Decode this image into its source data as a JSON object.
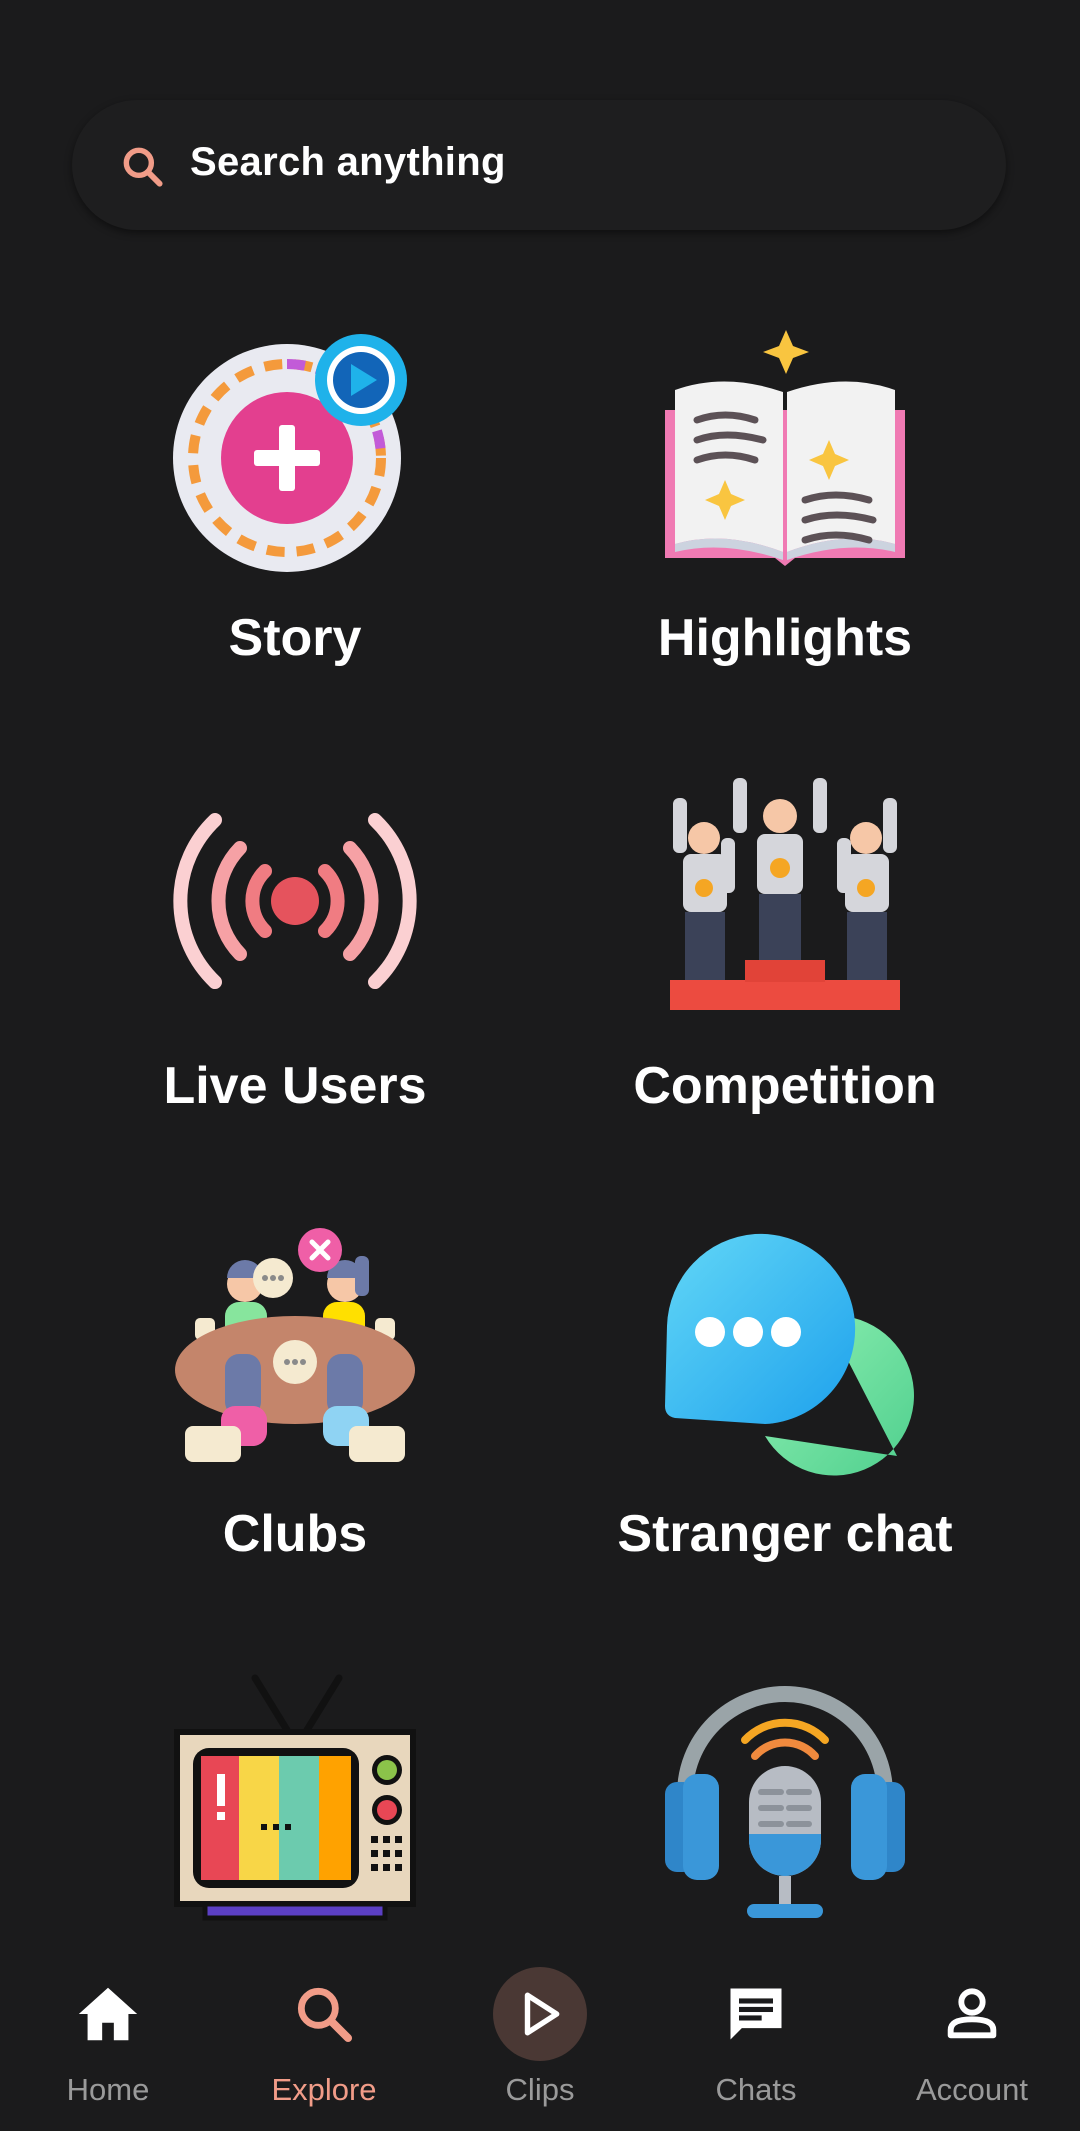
{
  "search": {
    "placeholder": "Search anything",
    "icon": "search-icon",
    "icon_color": "#f19c88"
  },
  "tiles": [
    {
      "label": "Story",
      "icon": "story-add-icon"
    },
    {
      "label": "Highlights",
      "icon": "open-book-icon"
    },
    {
      "label": "Live Users",
      "icon": "live-broadcast-icon"
    },
    {
      "label": "Competition",
      "icon": "podium-winners-icon"
    },
    {
      "label": "Clubs",
      "icon": "group-meeting-icon"
    },
    {
      "label": "Stranger chat",
      "icon": "chat-bubbles-icon"
    },
    {
      "label": "",
      "icon": "retro-tv-icon"
    },
    {
      "label": "",
      "icon": "podcast-microphone-icon"
    }
  ],
  "nav": {
    "active_color": "#f19c88",
    "items": [
      {
        "label": "Home",
        "icon": "home-icon"
      },
      {
        "label": "Explore",
        "icon": "search-icon",
        "active": true
      },
      {
        "label": "Clips",
        "icon": "play-icon"
      },
      {
        "label": "Chats",
        "icon": "chat-icon"
      },
      {
        "label": "Account",
        "icon": "account-icon"
      }
    ]
  }
}
